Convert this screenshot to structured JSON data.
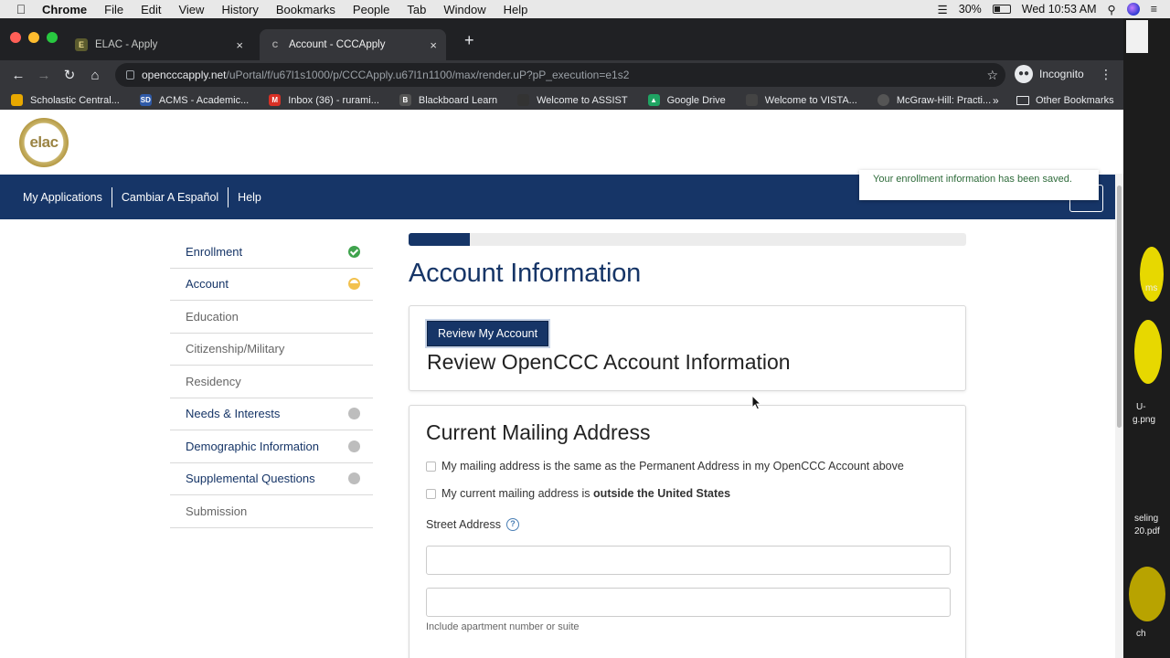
{
  "menubar": {
    "app": "Chrome",
    "items": [
      "File",
      "Edit",
      "View",
      "History",
      "Bookmarks",
      "People",
      "Tab",
      "Window",
      "Help"
    ],
    "battery": "30%",
    "clock": "Wed 10:53 AM"
  },
  "browser": {
    "tabs": [
      {
        "title": "ELAC - Apply",
        "active": false
      },
      {
        "title": "Account - CCCApply",
        "active": true
      }
    ],
    "url_host": "opencccapply.net",
    "url_path": "/uPortal/f/u67l1s1000/p/CCCApply.u67l1n1100/max/render.uP?pP_execution=e1s2",
    "profile": "Incognito",
    "bookmarks": [
      {
        "label": "Scholastic Central...",
        "icon_color": "#e8a800"
      },
      {
        "label": "ACMS - Academic...",
        "icon_color": "#2f5aa8"
      },
      {
        "label": "Inbox (36) - rurami...",
        "icon_color": "#d93025"
      },
      {
        "label": "Blackboard Learn",
        "icon_color": "#555555"
      },
      {
        "label": "Welcome to ASSIST",
        "icon_color": "#333333"
      },
      {
        "label": "Google Drive",
        "icon_color": "#1fa463"
      },
      {
        "label": "Welcome to VISTA...",
        "icon_color": "#444444"
      },
      {
        "label": "McGraw-Hill: Practi...",
        "icon_color": "#555555"
      }
    ],
    "bookmarks_more": "»",
    "other_bookmarks": "Other Bookmarks"
  },
  "site": {
    "logo_text": "elac",
    "nav": [
      "My Applications",
      "Cambiar A Español",
      "Help"
    ],
    "toast": "Your enrollment information has been saved."
  },
  "sidebar": {
    "items": [
      {
        "label": "Enrollment",
        "status": "done",
        "style": "link"
      },
      {
        "label": "Account",
        "status": "progress",
        "style": "link"
      },
      {
        "label": "Education",
        "status": "none",
        "style": "muted"
      },
      {
        "label": "Citizenship/Military",
        "status": "none",
        "style": "muted"
      },
      {
        "label": "Residency",
        "status": "none",
        "style": "muted"
      },
      {
        "label": "Needs & Interests",
        "status": "todo",
        "style": "link"
      },
      {
        "label": "Demographic Information",
        "status": "todo",
        "style": "link"
      },
      {
        "label": "Supplemental Questions",
        "status": "todo",
        "style": "link"
      },
      {
        "label": "Submission",
        "status": "none",
        "style": "muted"
      }
    ]
  },
  "main": {
    "progress": 0.11,
    "title": "Account Information",
    "review_button": "Review My Account",
    "review_heading": "Review OpenCCC Account Information",
    "mailing_heading": "Current Mailing Address",
    "checkbox_same": "My mailing address is the same as the Permanent Address in my OpenCCC Account above",
    "checkbox_outside_prefix": "My current mailing address is ",
    "checkbox_outside_bold": "outside the United States",
    "street_label": "Street Address",
    "street_line1_value": "",
    "street_line2_value": "",
    "street_hint": "Include apartment number or suite"
  },
  "desktop": {
    "labels": [
      "ms",
      "U-",
      "g.png",
      "seling",
      "20.pdf",
      "ch"
    ]
  }
}
